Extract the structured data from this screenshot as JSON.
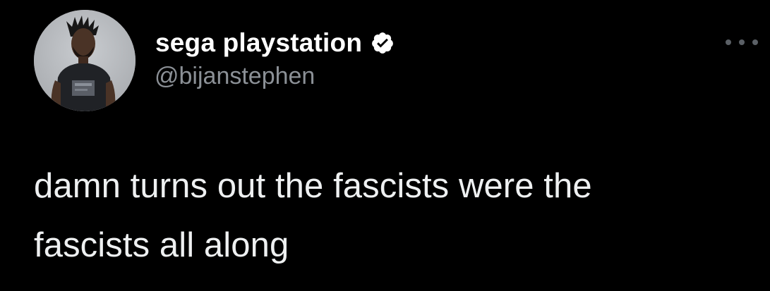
{
  "tweet": {
    "author": {
      "display_name": "sega playstation",
      "handle": "@bijanstephen",
      "verified": true,
      "avatar_icon": "profile-photo-avatar"
    },
    "text_line_1": "damn turns out the fascists were the",
    "text_line_2": "fascists all along",
    "menu_icon": "more-options-icon"
  },
  "colors": {
    "background": "#000000",
    "display_name": "#ffffff",
    "handle": "#8b9096",
    "body_text": "#eef0f1",
    "verified_badge": "#ffffff",
    "menu_dots": "#5b6066"
  }
}
